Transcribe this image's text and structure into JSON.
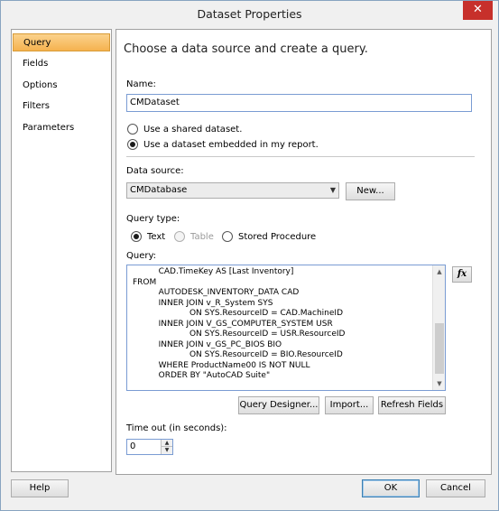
{
  "window": {
    "title": "Dataset Properties",
    "close_glyph": "✕"
  },
  "nav": {
    "items": [
      {
        "label": "Query",
        "active": true
      },
      {
        "label": "Fields",
        "active": false
      },
      {
        "label": "Options",
        "active": false
      },
      {
        "label": "Filters",
        "active": false
      },
      {
        "label": "Parameters",
        "active": false
      }
    ]
  },
  "main": {
    "heading": "Choose a data source and create a query.",
    "name_label": "Name:",
    "name_value": "CMDataset",
    "shared_dataset_label": "Use a shared dataset.",
    "embedded_dataset_label": "Use a dataset embedded in my report.",
    "selected_dataset_mode": "embedded",
    "data_source_label": "Data source:",
    "data_source_value": "CMDatabase",
    "new_button": "New...",
    "query_type_label": "Query type:",
    "query_types": [
      {
        "label": "Text",
        "selected": true,
        "enabled": true
      },
      {
        "label": "Table",
        "selected": false,
        "enabled": false
      },
      {
        "label": "Stored Procedure",
        "selected": false,
        "enabled": true
      }
    ],
    "query_label": "Query:",
    "query_text": "          CAD.TimeKey AS [Last Inventory]\nFROM\n          AUTODESK_INVENTORY_DATA CAD\n          INNER JOIN v_R_System SYS\n                      ON SYS.ResourceID = CAD.MachineID\n          INNER JOIN V_GS_COMPUTER_SYSTEM USR\n                      ON SYS.ResourceID = USR.ResourceID\n          INNER JOIN v_GS_PC_BIOS BIO\n                      ON SYS.ResourceID = BIO.ResourceID\n          WHERE ProductName00 IS NOT NULL\n          ORDER BY \"AutoCAD Suite\"",
    "fx_label": "fx",
    "query_designer_button": "Query Designer...",
    "import_button": "Import...",
    "refresh_fields_button": "Refresh Fields",
    "timeout_label": "Time out (in seconds):",
    "timeout_value": "0"
  },
  "footer": {
    "help_button": "Help",
    "ok_button": "OK",
    "cancel_button": "Cancel"
  },
  "colors": {
    "nav_active": "#f5b24f",
    "close_button": "#c7302b",
    "input_border": "#7a9cd3"
  }
}
